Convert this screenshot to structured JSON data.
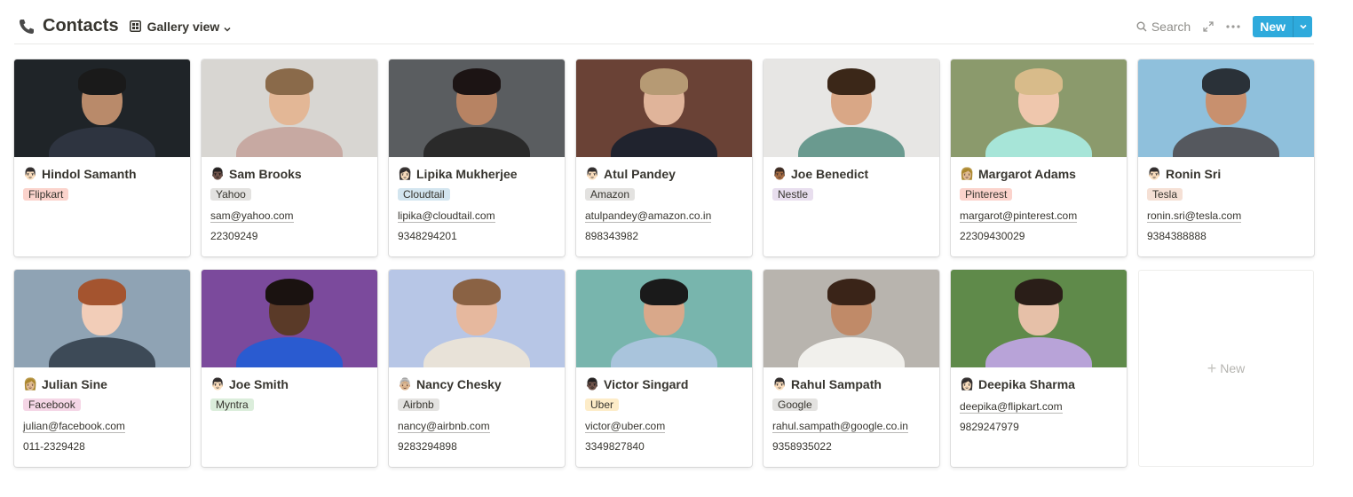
{
  "header": {
    "title": "Contacts",
    "view_label": "Gallery view",
    "search_label": "Search",
    "new_label": "New"
  },
  "colors": {
    "accent": "#2eaadc",
    "text": "#37352f",
    "muted": "#8f8e8a"
  },
  "icons": {
    "title": "phone-icon",
    "view": "gallery-view-icon",
    "view_menu": "chevron-down-icon",
    "search": "search-icon",
    "expand": "expand-icon",
    "more": "more-icon",
    "new_menu": "chevron-down-icon"
  },
  "contacts": [
    {
      "name": "Hindol Samanth",
      "emoji": "👨🏻",
      "company": "Flipkart",
      "email": "",
      "phone": ""
    },
    {
      "name": "Sam Brooks",
      "emoji": "👨🏿",
      "company": "Yahoo",
      "email": "sam@yahoo.com",
      "phone": "22309249"
    },
    {
      "name": "Lipika Mukherjee",
      "emoji": "👩🏻",
      "company": "Cloudtail",
      "email": "lipika@cloudtail.com",
      "phone": "9348294201"
    },
    {
      "name": "Atul Pandey",
      "emoji": "👨🏻",
      "company": "Amazon",
      "email": "atulpandey@amazon.co.in",
      "phone": "898343982"
    },
    {
      "name": "Joe Benedict",
      "emoji": "👨🏾",
      "company": "Nestle",
      "email": "",
      "phone": ""
    },
    {
      "name": "Margarot Adams",
      "emoji": "👩🏼",
      "company": "Pinterest",
      "email": "margarot@pinterest.com",
      "phone": "22309430029"
    },
    {
      "name": "Ronin Sri",
      "emoji": "👨🏻",
      "company": "Tesla",
      "email": "ronin.sri@tesla.com",
      "phone": "9384388888"
    },
    {
      "name": "Julian Sine",
      "emoji": "👩🏼",
      "company": "Facebook",
      "email": "julian@facebook.com",
      "phone": "011-2329428"
    },
    {
      "name": "Joe Smith",
      "emoji": "👨🏻",
      "company": "Myntra",
      "email": "",
      "phone": ""
    },
    {
      "name": "Nancy Chesky",
      "emoji": "👵🏼",
      "company": "Airbnb",
      "email": "nancy@airbnb.com",
      "phone": "9283294898"
    },
    {
      "name": "Victor Singard",
      "emoji": "👨🏿",
      "company": "Uber",
      "email": "victor@uber.com",
      "phone": "3349827840"
    },
    {
      "name": "Rahul Sampath",
      "emoji": "👨🏻",
      "company": "Google",
      "email": "rahul.sampath@google.co.in",
      "phone": "9358935022"
    },
    {
      "name": "Deepika Sharma",
      "emoji": "👩🏻",
      "company": "",
      "email": "deepika@flipkart.com",
      "phone": "9829247979"
    }
  ],
  "tag_colors": {
    "Flipkart": "#fbd3cc",
    "Yahoo": "#e3e2e0",
    "Cloudtail": "#d3e5ef",
    "Amazon": "#e3e2e0",
    "Nestle": "#e8deee",
    "Pinterest": "#fbd3cc",
    "Tesla": "#f5e0d5",
    "Facebook": "#f5d6e6",
    "Myntra": "#dbeddb",
    "Airbnb": "#e3e2e0",
    "Uber": "#fdecc8",
    "Google": "#e3e2e0"
  },
  "photos": [
    {
      "bg": "#1f2428",
      "skin": "#b98a6a",
      "hair": "#1a1a1a",
      "clothes": "#2e3440"
    },
    {
      "bg": "#d8d6d2",
      "skin": "#e3b796",
      "hair": "#8a6a4a",
      "clothes": "#c7a9a2"
    },
    {
      "bg": "#5a5d60",
      "skin": "#b78363",
      "hair": "#1c1414",
      "clothes": "#2a2a2a"
    },
    {
      "bg": "#6a4236",
      "skin": "#e0b49a",
      "hair": "#b69a74",
      "clothes": "#20232e"
    },
    {
      "bg": "#e7e6e4",
      "skin": "#d9a786",
      "hair": "#3b2718",
      "clothes": "#6a9a8f"
    },
    {
      "bg": "#8b9a6c",
      "skin": "#efc7ad",
      "hair": "#d8bb8a",
      "clothes": "#a7e5d8"
    },
    {
      "bg": "#8fc0dc",
      "skin": "#c8906e",
      "hair": "#2a3138",
      "clothes": "#55585e"
    },
    {
      "bg": "#8fa3b4",
      "skin": "#f2cdb8",
      "hair": "#a4542f",
      "clothes": "#3d4a57"
    },
    {
      "bg": "#7b4a9c",
      "skin": "#5a3a28",
      "hair": "#1a1210",
      "clothes": "#2a5bd0"
    },
    {
      "bg": "#b7c6e6",
      "skin": "#e6b89e",
      "hair": "#8a6244",
      "clothes": "#e8e2d8"
    },
    {
      "bg": "#78b5ad",
      "skin": "#d9a88a",
      "hair": "#1a1a1a",
      "clothes": "#a9c4dc"
    },
    {
      "bg": "#b8b4ae",
      "skin": "#c08a68",
      "hair": "#3a2418",
      "clothes": "#f1f0ec"
    },
    {
      "bg": "#5f8a4a",
      "skin": "#e6c0a8",
      "hair": "#2a1e18",
      "clothes": "#b8a3d8"
    }
  ],
  "new_card_label": "New"
}
